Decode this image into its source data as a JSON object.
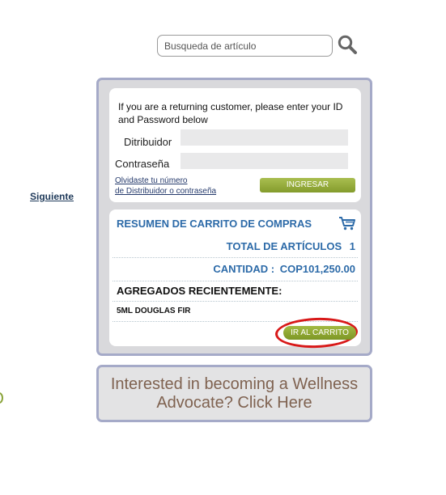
{
  "search": {
    "placeholder": "Busqueda de artículo",
    "icon": "search-icon"
  },
  "nav": {
    "next_label": "Siguiente"
  },
  "login": {
    "intro": "If you are a returning customer, please enter your ID and Password below",
    "distributor_label": "Ditribuidor",
    "password_label": "Contraseña",
    "forgot_line1": "Olvidaste tu número",
    "forgot_line2": "de Distribuidor o contraseña",
    "button_label": "INGRESAR"
  },
  "cart": {
    "title": "RESUMEN DE CARRITO DE COMPRAS",
    "icon": "shopping-cart-icon",
    "total_label": "TOTAL DE ARTÍCULOS",
    "total_value": "1",
    "amount_label": "CANTIDAD :",
    "amount_value": "COP101,250.00",
    "recent_title": "AGREGADOS RECIENTEMENTE:",
    "recent_items": [
      "5ML DOUGLAS FIR"
    ],
    "button_label": "IR AL CARRITO"
  },
  "wellness": {
    "label": "Interested in becoming a Wellness Advocate? Click Here"
  },
  "colors": {
    "accent_blue": "#2c6aa8",
    "button_green": "#8aa43a",
    "highlight_red": "#d81919",
    "panel_border": "#a5aac8",
    "wellness_text": "#7f6250"
  }
}
